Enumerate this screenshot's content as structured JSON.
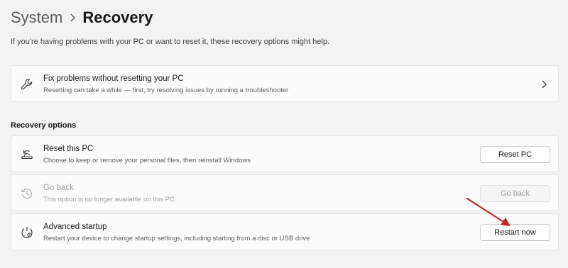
{
  "breadcrumb": {
    "parent": "System",
    "current": "Recovery"
  },
  "description": "If you're having problems with your PC or want to reset it, these recovery options might help.",
  "fix_card": {
    "title": "Fix problems without resetting your PC",
    "subtitle": "Resetting can take a while — first, try resolving issues by running a troubleshooter",
    "icon": "wrench-icon"
  },
  "section_heading": "Recovery options",
  "options": [
    {
      "title": "Reset this PC",
      "subtitle": "Choose to keep or remove your personal files, then reinstall Windows",
      "button": "Reset PC",
      "icon": "reset-pc-icon",
      "disabled": false
    },
    {
      "title": "Go back",
      "subtitle": "This option is no longer available on this PC",
      "button": "Go back",
      "icon": "history-icon",
      "disabled": true
    },
    {
      "title": "Advanced startup",
      "subtitle": "Restart your device to change startup settings, including starting from a disc or USB drive",
      "button": "Restart now",
      "icon": "advanced-startup-icon",
      "disabled": false
    }
  ],
  "colors": {
    "background": "#f3f3f3",
    "card": "#fbfbfb",
    "annotation_arrow": "#c0262d"
  }
}
